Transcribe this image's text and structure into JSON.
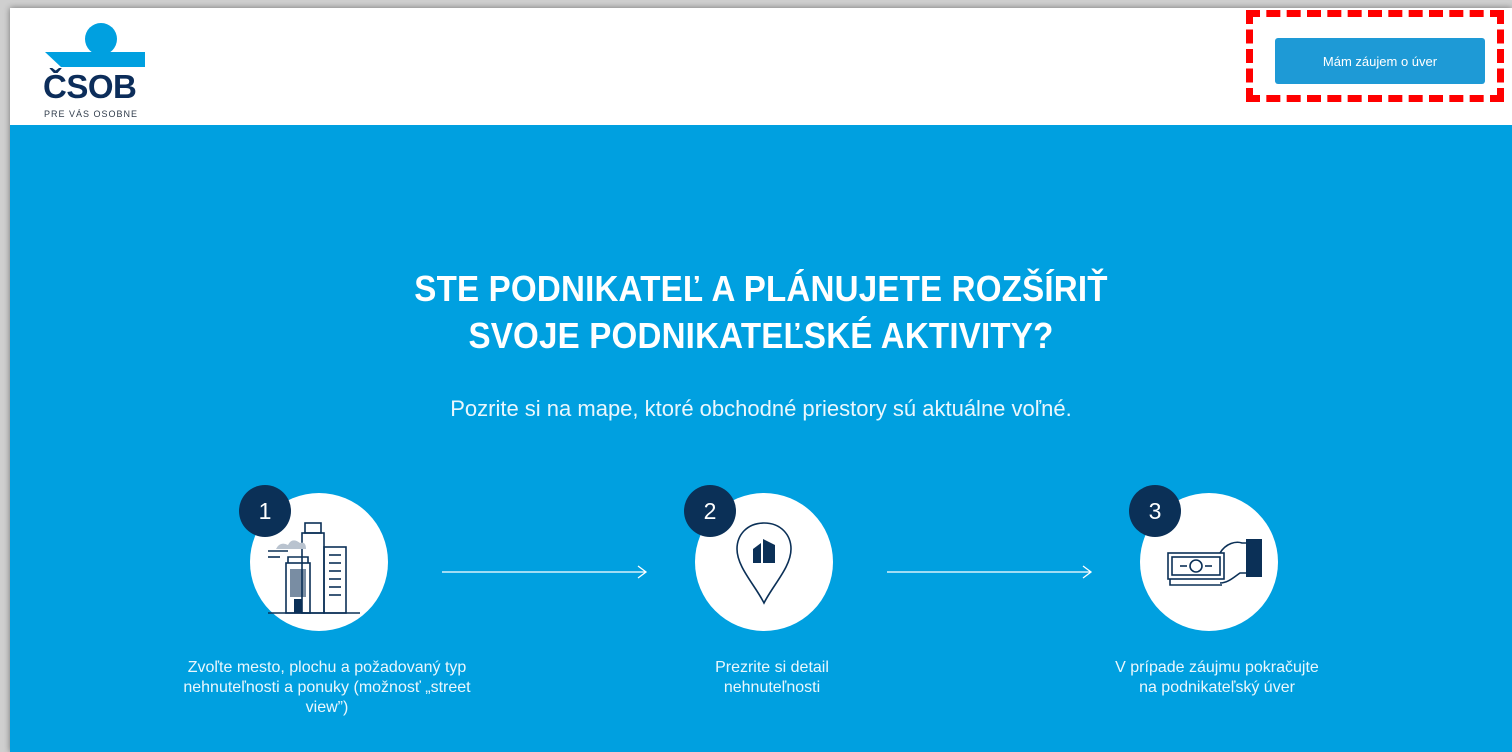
{
  "header": {
    "logo": {
      "wordmark": "ČSOB",
      "tagline": "PRE VÁS OSOBNE"
    },
    "cta_label": "Mám záujem o úver"
  },
  "hero": {
    "title_line1": "STE PODNIKATEĽ A PLÁNUJETE ROZŠÍRIŤ",
    "title_line2": "SVOJE PODNIKATEĽSKÉ AKTIVITY?",
    "subtitle": "Pozrite si na mape, ktoré obchodné priestory sú aktuálne voľné."
  },
  "steps": [
    {
      "number": "1",
      "icon": "city-buildings-icon",
      "label_lines": [
        "Zvoľte mesto, plochu a požadovaný typ",
        "nehnuteľnosti a ponuky (možnosť „street",
        "view”)"
      ]
    },
    {
      "number": "2",
      "icon": "map-pin-building-icon",
      "label_lines": [
        "Prezrite si detail",
        "nehnuteľnosti"
      ]
    },
    {
      "number": "3",
      "icon": "hand-money-icon",
      "label_lines": [
        "V prípade záujmu pokračujte",
        "na podnikateľský úver"
      ]
    }
  ],
  "colors": {
    "hero_bg": "#00a0e0",
    "cta_bg": "#1e9ad6",
    "badge_bg": "#0b3057",
    "logo_dark": "#0c2d5a",
    "highlight": "#ff0000"
  }
}
